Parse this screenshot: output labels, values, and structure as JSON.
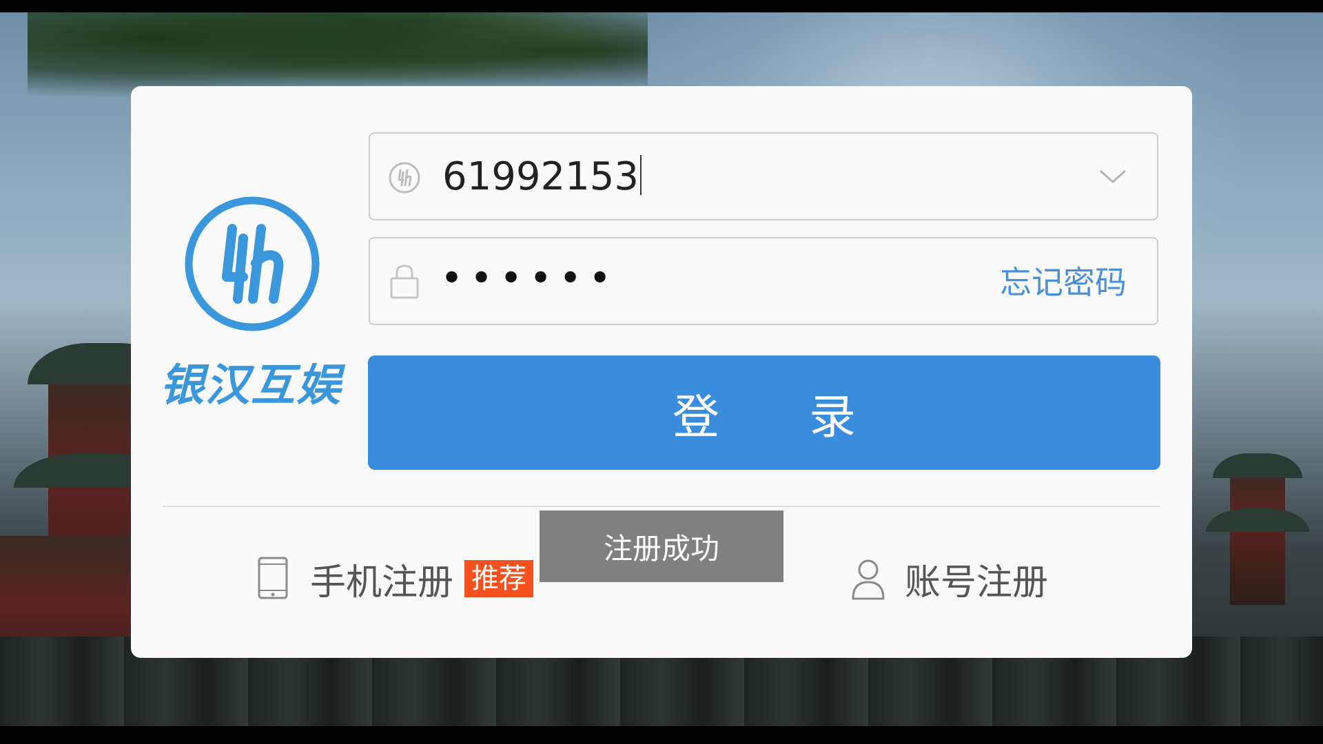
{
  "brand": {
    "name": "银汉互娱",
    "logo_glyph": "yh",
    "color": "#3a97dc"
  },
  "login_form": {
    "account": {
      "value": "61992153",
      "icon": "brand-badge-icon",
      "dropdown_icon": "chevron-down-icon"
    },
    "password": {
      "masked_value": "••••••",
      "icon": "lock-icon",
      "forgot_label": "忘记密码"
    },
    "login_label": "登录",
    "accent_color": "#3a8ddd"
  },
  "register": {
    "phone_label": "手机注册",
    "phone_icon": "smartphone-icon",
    "recommend_badge": "推荐",
    "account_label": "账号注册",
    "account_icon": "user-icon"
  },
  "toast": {
    "message": "注册成功"
  }
}
